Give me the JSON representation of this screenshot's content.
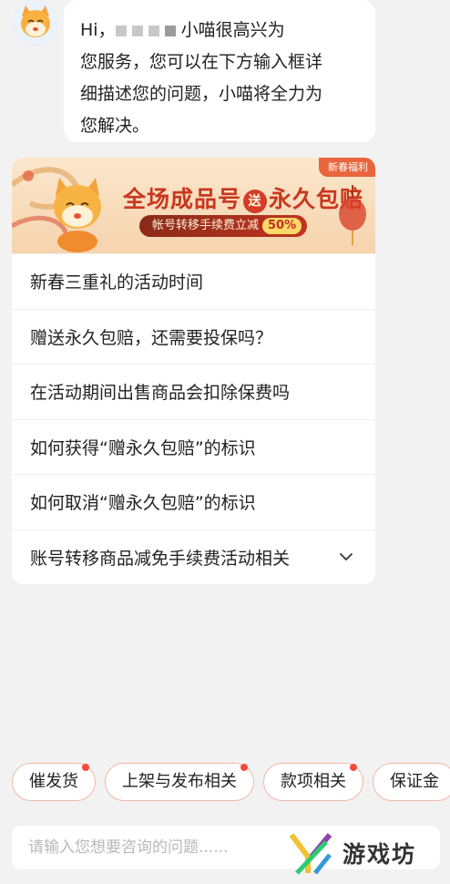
{
  "greeting": {
    "prefix": "Hi，",
    "line1_rest": "小喵很高兴为",
    "line2": "您服务，您可以在下方输入框详",
    "line3": "细描述您的问题，小喵将全力为",
    "line4": "您解决。"
  },
  "banner": {
    "corner_tag": "新春福利",
    "headline_left": "全场成品号",
    "headline_seal": "送",
    "headline_right": "永久包赔",
    "ribbon_text": "帐号转移手续费立减",
    "ribbon_badge": "50%"
  },
  "faq": {
    "items": [
      "新春三重礼的活动时间",
      "赠送永久包赔，还需要投保吗？",
      "在活动期间出售商品会扣除保费吗",
      "如何获得“赠永久包赔”的标识",
      "如何取消“赠永久包赔”的标识",
      "账号转移商品减免手续费活动相关"
    ]
  },
  "chips": [
    "催发货",
    "上架与发布相关",
    "款项相关",
    "保证金"
  ],
  "input": {
    "placeholder": "请输入您想要咨询的问题......"
  },
  "watermark": {
    "text": "游戏坊"
  },
  "colors": {
    "accent": "#f24b3c",
    "chip_border": "#f0b8a4",
    "banner_red": "#c8371f",
    "background": "#f2f2f3"
  },
  "icons": {
    "avatar": "cat-mascot-icon",
    "expand": "chevron-down-icon"
  }
}
